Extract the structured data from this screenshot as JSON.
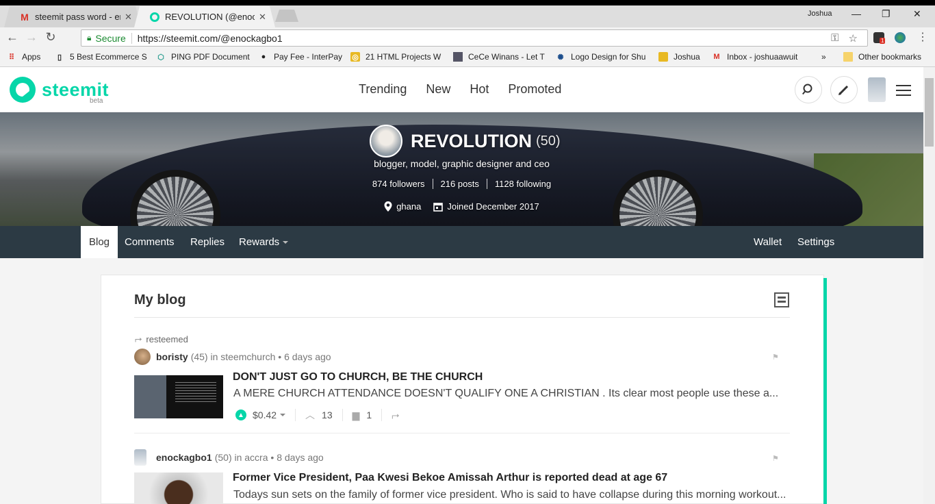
{
  "browser": {
    "tabs": [
      {
        "title": "steemit pass word - enoc",
        "favicon": "gmail-icon"
      },
      {
        "title": "REVOLUTION (@enockag",
        "favicon": "steemit-icon"
      }
    ],
    "profile_name": "Joshua",
    "secure_label": "Secure",
    "url": "https://steemit.com/@enockagbo1",
    "bookmarks": [
      {
        "label": "Apps"
      },
      {
        "label": "5 Best Ecommerce S"
      },
      {
        "label": "PING PDF Document"
      },
      {
        "label": "Pay Fee - InterPay"
      },
      {
        "label": "21 HTML Projects W"
      },
      {
        "label": "CeCe Winans - Let T"
      },
      {
        "label": "Logo Design for Shu"
      },
      {
        "label": "Joshua"
      },
      {
        "label": "Inbox - joshuaawuit"
      },
      {
        "label": "Other bookmarks"
      }
    ],
    "overflow": "»",
    "ext_badge": "1"
  },
  "site": {
    "logo": "steemit",
    "beta": "beta",
    "nav": [
      "Trending",
      "New",
      "Hot",
      "Promoted"
    ]
  },
  "profile": {
    "name": "REVOLUTION",
    "reputation": "(50)",
    "about": "blogger, model, graphic designer and ceo",
    "followers": "874 followers",
    "posts": "216 posts",
    "following": "1128 following",
    "location": "ghana",
    "joined": "Joined December 2017"
  },
  "profile_tabs": {
    "blog": "Blog",
    "comments": "Comments",
    "replies": "Replies",
    "rewards": "Rewards",
    "wallet": "Wallet",
    "settings": "Settings"
  },
  "blog": {
    "heading": "My blog",
    "posts": [
      {
        "resteemed": "resteemed",
        "author": "boristy",
        "rep": "(45) in steemchurch • 6 days ago",
        "title": "DON'T JUST GO TO CHURCH, BE THE CHURCH",
        "body": "A MERE CHURCH ATTENDANCE DOESN'T QUALIFY ONE A CHRISTIAN . Its clear most people use these a...",
        "payout": "$0.42",
        "votes": "13",
        "comments": "1"
      },
      {
        "author": "enockagbo1",
        "rep": "(50) in accra • 8 days ago",
        "title": "Former Vice President, Paa Kwesi Bekoe Amissah Arthur is reported dead at age 67",
        "body": "Todays sun sets on the family of former vice president. Who is said to have collapse during this morning workout..."
      }
    ]
  },
  "colors": {
    "accent": "#06d6a9",
    "tabbar": "#2c3a44"
  }
}
